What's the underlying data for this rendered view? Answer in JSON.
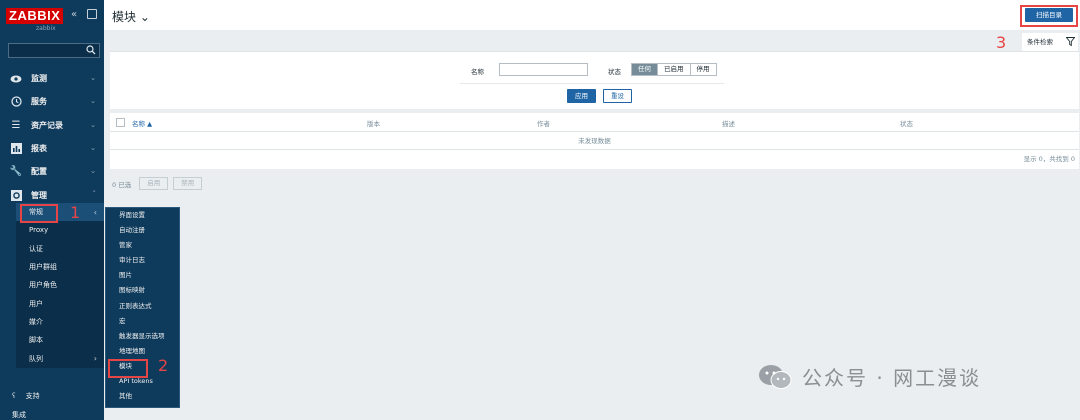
{
  "sidebar": {
    "logo": "ZABBIX",
    "logo_sub": "zabbix",
    "search_placeholder": "",
    "menu": [
      {
        "label": "监测",
        "icon": "eye-icon"
      },
      {
        "label": "服务",
        "icon": "clock-icon"
      },
      {
        "label": "资产记录",
        "icon": "list-icon"
      },
      {
        "label": "报表",
        "icon": "bar-chart-icon"
      },
      {
        "label": "配置",
        "icon": "wrench-icon"
      },
      {
        "label": "管理",
        "icon": "gear-icon"
      }
    ],
    "admin_submenu": [
      "常规",
      "Proxy",
      "认证",
      "用户群组",
      "用户角色",
      "用户",
      "媒介",
      "脚本",
      "队列"
    ],
    "support": "支持",
    "bottom": "集成"
  },
  "flyout": {
    "items": [
      "界面设置",
      "自动注册",
      "管家",
      "审计日志",
      "图片",
      "图标映射",
      "正则表达式",
      "宏",
      "触发器显示选项",
      "地理地图",
      "模块",
      "API tokens",
      "其他"
    ]
  },
  "header": {
    "title": "模块",
    "scan_button": "扫描目录"
  },
  "filter": {
    "tab_label": "条件检索",
    "name_label": "名称",
    "name_value": "",
    "status_label": "状态",
    "status_options": [
      "任何",
      "已启用",
      "停用"
    ],
    "status_selected": "任何",
    "apply": "应用",
    "reset": "重设"
  },
  "table": {
    "columns": [
      "名称 ▲",
      "版本",
      "作者",
      "描述",
      "状态"
    ],
    "empty_text": "未发现数据",
    "count_text": "显示 0，共找到 0"
  },
  "actions": {
    "selected": "0 已选",
    "enable": "启用",
    "disable": "禁用"
  },
  "annotations": {
    "n1": "1",
    "n2": "2",
    "n3": "3",
    "color": "#e64545"
  },
  "watermark": "公众号 · 网工漫谈"
}
